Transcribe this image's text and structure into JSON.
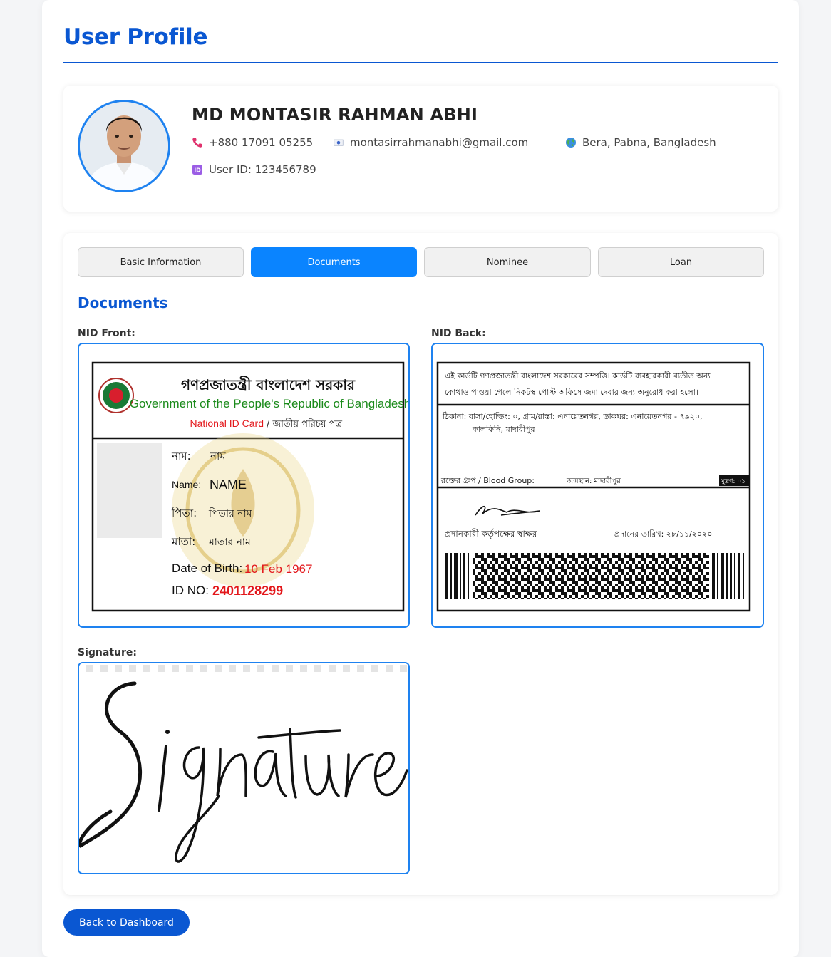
{
  "page_title": "User Profile",
  "profile": {
    "name": "MD MONTASIR RAHMAN ABHI",
    "phone": "+880 17091 05255",
    "email": "montasirrahmanabhi@gmail.com",
    "location": "Bera, Pabna, Bangladesh",
    "user_id": "User ID: 123456789"
  },
  "tabs": [
    {
      "label": "Basic Information",
      "active": false
    },
    {
      "label": "Documents",
      "active": true
    },
    {
      "label": "Nominee",
      "active": false
    },
    {
      "label": "Loan",
      "active": false
    }
  ],
  "documents": {
    "heading": "Documents",
    "nid_front_label": "NID Front:",
    "nid_back_label": "NID Back:",
    "signature_label": "Signature:"
  },
  "nid_front": {
    "header_bn": "গণপ্রজাতন্ত্রী বাংলাদেশ সরকার",
    "header_en": "Government of the People's Republic of Bangladesh",
    "card_en": "National ID Card",
    "card_bn": "/ জাতীয় পরিচয় পত্র",
    "name_bn_label": "নাম:",
    "name_bn_value": "নাম",
    "name_label": "Name:",
    "name_value": "NAME",
    "father_label": "পিতা:",
    "father_value": "পিতার নাম",
    "mother_label": "মাতা:",
    "mother_value": "মাতার নাম",
    "dob_label": "Date of Birth:",
    "dob_value": "10 Feb 1967",
    "id_label": "ID NO:",
    "id_value": "2401128299"
  },
  "nid_back": {
    "notice_line1": "এই কার্ডটি গণপ্রজাতন্ত্রী বাংলাদেশ সরকারের সম্পত্তি। কার্ডটি ব্যবহারকারী ব্যতীত অন্য",
    "notice_line2": "কোথাও পাওয়া গেলে নিকটস্থ পোস্ট অফিসে জমা দেবার জন্য অনুরোধ করা হলো।",
    "address_line1": "ঠিকানা: বাসা/হোল্ডিং: ০, গ্রাম/রাস্তা: এনায়েতনগর, ডাকঘর: এনায়েতনগর - ৭৯২০,",
    "address_line2": "কালকিনি, মাদারীপুর",
    "blood_group": "রক্তের গ্রুপ / Blood Group:",
    "birth_place": "জন্মস্থান: মাদারীপুর",
    "print_no": "মুদ্রণ: ০১",
    "authority_sign": "প্রদানকারী কর্তৃপক্ষের স্বাক্ষর",
    "issue_date": "প্রদানের তারিখ: ২৮/১১/২০২০"
  },
  "signature_text": "Signature",
  "back_button": "Back to Dashboard",
  "colors": {
    "accent": "#0a57d2",
    "tab_active": "#0a84ff",
    "frame_border": "#1e82f0",
    "nid_green": "#1a8a1a",
    "nid_red": "#e3171b"
  }
}
